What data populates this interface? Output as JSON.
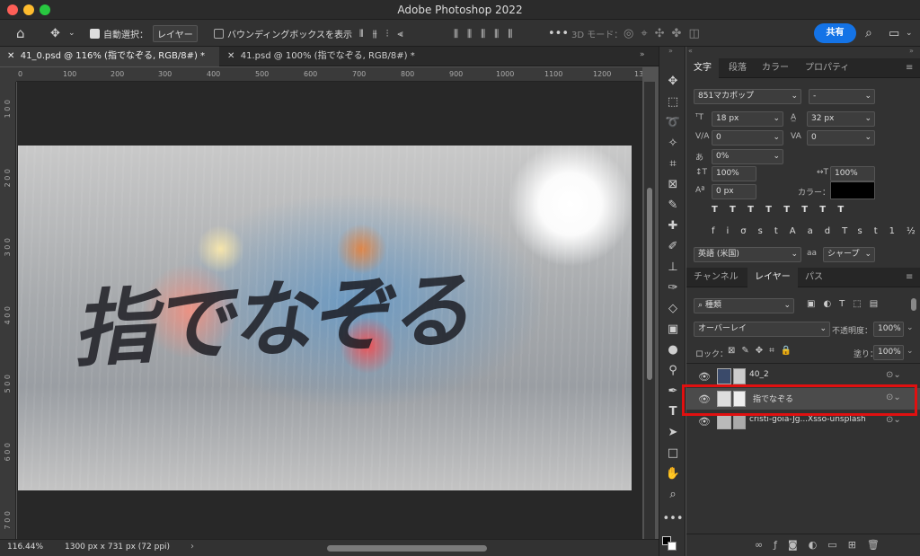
{
  "window": {
    "title": "Adobe Photoshop 2022"
  },
  "options_bar": {
    "auto_select_label": "自動選択：",
    "auto_select_target": "レイヤー",
    "show_transform_label": "バウンディングボックスを表示",
    "mode_3d_label": "3D モード：",
    "share_label": "共有"
  },
  "tabs": [
    {
      "label": "41_0.psd @ 116% (指でなぞる, RGB/8#) *",
      "active": true
    },
    {
      "label": "41.psd @ 100% (指でなぞる, RGB/8#) *",
      "active": false
    }
  ],
  "ruler": {
    "h_ticks": [
      "0",
      "100",
      "200",
      "300",
      "400",
      "500",
      "600",
      "700",
      "800",
      "900",
      "1000",
      "1100",
      "1200",
      "13"
    ],
    "v_ticks": [
      "1\n0\n0",
      "2\n0\n0",
      "3\n0\n0",
      "4\n0\n0",
      "5\n0\n0",
      "6\n0\n0",
      "7\n0\n0"
    ]
  },
  "canvas": {
    "handwritten_text": "指でなぞる"
  },
  "status": {
    "zoom": "116.44%",
    "doc_size": "1300 px x 731 px (72 ppi)"
  },
  "char_panel": {
    "tabs": [
      "文字",
      "段落",
      "カラー",
      "プロパティ"
    ],
    "font_family": "851マカポップ",
    "font_style": "-",
    "font_size": "18 px",
    "leading": "32 px",
    "kerning": "0",
    "tracking": "0",
    "tsume": "0%",
    "vertical_scale": "100%",
    "horizontal_scale": "100%",
    "baseline_shift": "0 px",
    "color_label": "カラー：",
    "language": "英語 (米国)",
    "antialias": "シャープ",
    "aa_label": "aa"
  },
  "layers_panel": {
    "tabs": [
      "チャンネル",
      "レイヤー",
      "パス"
    ],
    "filter_kind": "種類",
    "blend_mode": "オーバーレイ",
    "opacity_label": "不透明度：",
    "opacity": "100%",
    "lock_label": "ロック：",
    "fill_label": "塗り：",
    "fill": "100%",
    "layers": [
      {
        "name": "40_2",
        "selected": false
      },
      {
        "name": "指でなぞる",
        "selected": true
      },
      {
        "name": "cristi-goia-Jg...Xsso-unsplash",
        "selected": false
      }
    ]
  },
  "colors": {
    "accent": "#1473e6",
    "highlight": "#e01010"
  }
}
